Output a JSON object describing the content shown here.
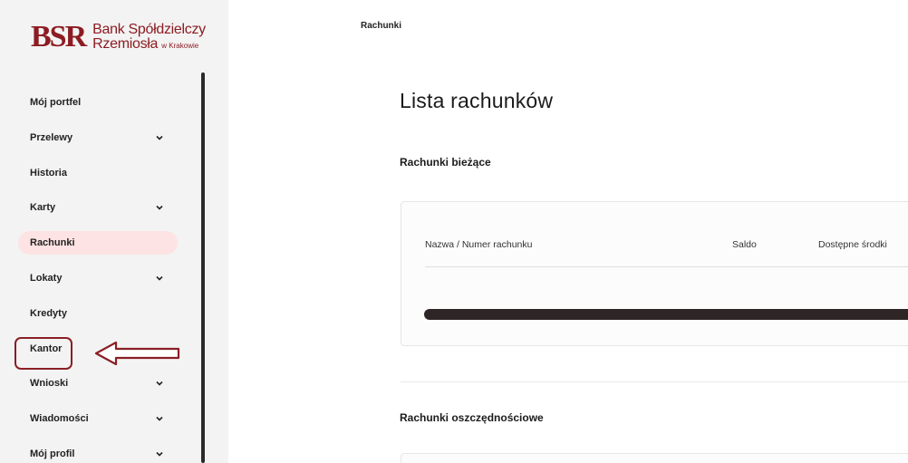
{
  "logo": {
    "mark": "BSR",
    "line1": "Bank Spółdzielczy",
    "line2": "Rzemiosła",
    "line2_small": "w Krakowie"
  },
  "sidebar": {
    "items": [
      {
        "label": "Mój portfel",
        "has_chevron": false
      },
      {
        "label": "Przelewy",
        "has_chevron": true
      },
      {
        "label": "Historia",
        "has_chevron": false
      },
      {
        "label": "Karty",
        "has_chevron": true
      },
      {
        "label": "Rachunki",
        "has_chevron": false,
        "active": true
      },
      {
        "label": "Lokaty",
        "has_chevron": true
      },
      {
        "label": "Kredyty",
        "has_chevron": false
      },
      {
        "label": "Kantor",
        "has_chevron": false,
        "highlighted": true
      },
      {
        "label": "Wnioski",
        "has_chevron": true
      },
      {
        "label": "Wiadomości",
        "has_chevron": true
      },
      {
        "label": "Mój profil",
        "has_chevron": true
      }
    ]
  },
  "breadcrumb": "Rachunki",
  "main": {
    "title": "Lista rachunków",
    "current_section": "Rachunki bieżące",
    "savings_section": "Rachunki oszczędnościowe",
    "columns": {
      "name": "Nazwa / Numer rachunku",
      "saldo": "Saldo",
      "available": "Dostępne środki"
    }
  },
  "colors": {
    "brand": "#8c1c22",
    "active_bg": "#fde3e3",
    "annotation": "#8a1f25",
    "loader": "#2e2626"
  }
}
